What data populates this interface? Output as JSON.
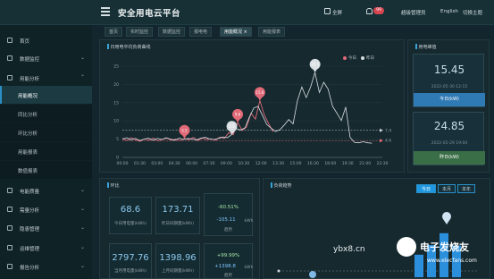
{
  "header": {
    "title": "安全用电云平台",
    "fullscreen": "全屏",
    "notify_count": "99",
    "user": "超级管理员",
    "language": "English",
    "switch_theme": "切换主题"
  },
  "sidebar": {
    "items": [
      {
        "label": "首页"
      },
      {
        "label": "数据监控"
      },
      {
        "label": "用能分析"
      },
      {
        "label": "电能质量"
      },
      {
        "label": "需量分析"
      },
      {
        "label": "隐患管理"
      },
      {
        "label": "运维管理"
      },
      {
        "label": "报告分析"
      }
    ],
    "subitems": [
      {
        "label": "用能概况"
      },
      {
        "label": "同比分析"
      },
      {
        "label": "环比分析"
      },
      {
        "label": "用能报表"
      },
      {
        "label": "数值报表"
      }
    ]
  },
  "tabs": [
    {
      "label": "首页"
    },
    {
      "label": "实时监控"
    },
    {
      "label": "数据监控"
    },
    {
      "label": "报电电"
    },
    {
      "label": "用能概况 ×"
    },
    {
      "label": "用能报表"
    }
  ],
  "load_chart": {
    "title": "日用电平均负荷曲线",
    "legend_today": "今日",
    "legend_yesterday": "昨日",
    "line_a_label": "7.4",
    "line_b_label": "4.6",
    "pin_labels": [
      "5.5",
      "9.6",
      "15.6",
      "19.3"
    ]
  },
  "chart_data": {
    "type": "line",
    "title": "日用电平均负荷曲线",
    "x": [
      "00:00",
      "01:30",
      "03:00",
      "04:30",
      "06:00",
      "07:30",
      "09:00",
      "10:30",
      "12:00",
      "13:30",
      "15:00",
      "16:30",
      "18:00",
      "19:30",
      "21:00",
      "22:30"
    ],
    "ylim": [
      0,
      25
    ],
    "yticks": [
      0,
      5,
      10,
      15,
      20,
      25
    ],
    "series": [
      {
        "name": "今日",
        "color": "#e06a78",
        "values": [
          5.2,
          4.6,
          5.4,
          4.8,
          4.4,
          5.1,
          4.7,
          5.3,
          4.5,
          4.9,
          5.3,
          4.7,
          5.0,
          4.6,
          5.2,
          4.8,
          5.5,
          4.6,
          5.3,
          4.9,
          5.1,
          4.7,
          5.6,
          5.2,
          6.8,
          6.2,
          9.6,
          7.4,
          8.3,
          12.1,
          10.5,
          15.6,
          11.6,
          9.2,
          7.0
        ]
      },
      {
        "name": "昨日",
        "color": "#d9dfe2",
        "values": [
          5.0,
          5.4,
          4.8,
          5.2,
          4.6,
          5.0,
          5.3,
          4.7,
          5.2,
          4.9,
          5.4,
          5.0,
          4.7,
          5.3,
          4.9,
          5.2,
          5.0,
          4.8,
          5.3,
          5.5,
          5.0,
          4.9,
          5.2,
          5.6,
          5.4,
          6.3,
          7.9,
          7.5,
          8.1,
          11.0,
          13.5,
          14.0,
          11.5,
          9.0,
          8.0,
          7.1,
          7.6,
          8.9,
          10.4,
          9.2,
          15.6,
          19.3,
          16.4,
          19.3,
          23.3,
          17.8,
          20.6,
          18.7,
          14.0,
          12.1,
          10.1,
          13.8,
          5.5,
          4.1,
          4.0,
          4.3,
          4.0,
          3.9
        ]
      }
    ],
    "reference_lines": [
      {
        "label": "7.4",
        "value": 7.4
      },
      {
        "label": "4.6",
        "value": 4.6
      }
    ],
    "pins": [
      {
        "label": "5.5",
        "color": "#e06a78"
      },
      {
        "label": "9.6",
        "color": "#e06a78"
      },
      {
        "label": "15.6",
        "color": "#e06a78"
      },
      {
        "label": "5.5",
        "color": "#d9dfe2"
      },
      {
        "label": "19.3",
        "color": "#d9dfe2"
      }
    ]
  },
  "peak_panel": {
    "title": "用电峰值",
    "today_value": "15.45",
    "today_time": "2022-05-30 12:15",
    "today_btn": "今日(kW)",
    "yesterday_value": "24.85",
    "yesterday_time": "2022-05-29 19:00",
    "yesterday_btn": "昨日(kW)"
  },
  "compare": {
    "title": "环比",
    "boxes": [
      {
        "value": "68.6",
        "label": "今日用电量(kWh)"
      },
      {
        "value": "173.71",
        "label": "昨日同期量(kWh)"
      },
      {
        "value": "2797.76",
        "label": "当月用电量(kWh)"
      },
      {
        "value": "1398.96",
        "label": "上月同期量(kWh)"
      }
    ],
    "day_pct": "-60.51%",
    "day_diff": "-105.11",
    "day_diff_unit": "kWh",
    "day_trend": "趋势",
    "month_pct": "+99.99%",
    "month_diff": "+1398.8",
    "month_diff_unit": "kWh",
    "month_trend": "趋势"
  },
  "trend": {
    "title": "负荷趋势",
    "periods": [
      "今日",
      "本月",
      "本年"
    ],
    "bars": [
      4.2,
      6.0,
      8.2,
      5.9
    ]
  },
  "watermark": {
    "text": "ybx8.cn",
    "brand": "电子发烧友",
    "site": "www.elecfans.com"
  },
  "colors": {
    "accent": "#2b8fc6",
    "today": "#e06a78",
    "yesterday": "#d9dfe2",
    "btn_today": "#2f79b4",
    "btn_yesterday": "#3a6e47"
  }
}
